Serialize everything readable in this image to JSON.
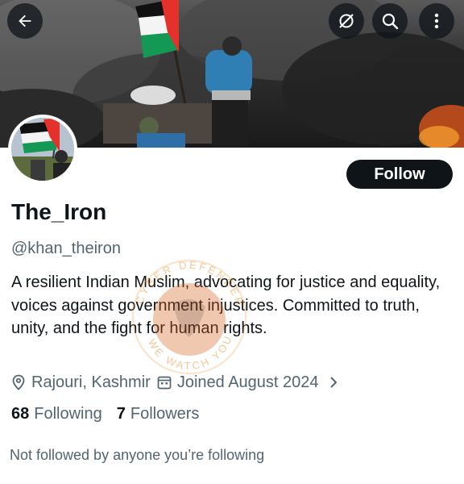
{
  "header": {
    "back_icon": "arrow-left-icon",
    "nodisturb_icon": "no-disturb-icon",
    "search_icon": "search-icon",
    "more_icon": "more-vertical-icon"
  },
  "banner": {
    "description_icon": "protest-photo-banner",
    "flag_colors": [
      "#000000",
      "#ffffff",
      "#149954",
      "#e4312b"
    ]
  },
  "profile": {
    "display_name": "The_Iron",
    "handle": "@khan_theiron",
    "bio": "A resilient Indian Muslim, advocating for justice and equality, voices against government injustices. Committed to truth, unity, and the fight for human rights.",
    "location": "Rajouri, Kashmir",
    "joined": "Joined August 2024",
    "location_icon": "location-pin-icon",
    "calendar_icon": "calendar-icon",
    "chevron_icon": "chevron-right-icon"
  },
  "actions": {
    "follow_label": "Follow"
  },
  "stats": {
    "following_count": "68",
    "following_label": "Following",
    "followers_count": "7",
    "followers_label": "Followers"
  },
  "social_context": "Not followed by anyone you’re following",
  "watermark": {
    "top_text": "CYBER DEFENDER",
    "bottom_text": "WE WATCH YOU"
  },
  "colors": {
    "text_primary": "#0f1419",
    "text_secondary": "#536471",
    "button_bg": "#0f1419",
    "button_text": "#ffffff"
  }
}
